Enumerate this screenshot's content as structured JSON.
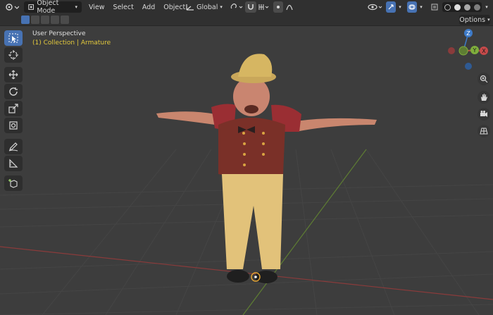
{
  "header": {
    "mode_label": "Object Mode",
    "menus": [
      "View",
      "Select",
      "Add",
      "Object"
    ],
    "transform_orientation": "Global"
  },
  "viewport": {
    "view_name": "User Perspective",
    "collection_info": "(1) Collection | Armature",
    "options_label": "Options",
    "gizmo_axes": [
      "Z",
      "Y",
      "X"
    ]
  },
  "colors": {
    "accent": "#4772b3",
    "header_bg": "#303030",
    "viewport_bg": "#3d3d3d",
    "x_axis": "#c64a4a",
    "y_axis": "#7fae3c",
    "z_axis": "#3d7ac8",
    "info_text": "#e3c93d"
  }
}
